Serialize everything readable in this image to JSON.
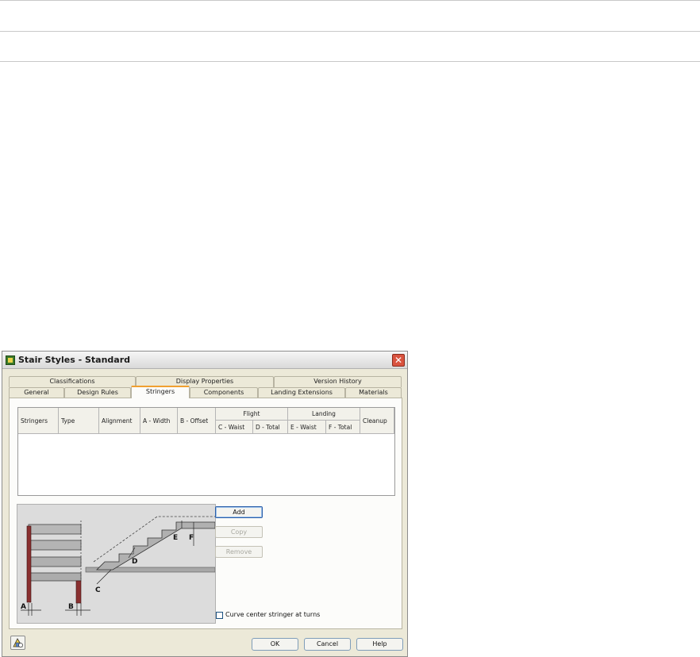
{
  "dialog": {
    "title": "Stair Styles - Standard",
    "close_glyph": "✕"
  },
  "tabs": {
    "row1": [
      {
        "label": "Classifications"
      },
      {
        "label": "Display Properties"
      },
      {
        "label": "Version History"
      }
    ],
    "row2": [
      {
        "label": "General"
      },
      {
        "label": "Design Rules"
      },
      {
        "label": "Stringers",
        "active": true
      },
      {
        "label": "Components"
      },
      {
        "label": "Landing Extensions"
      },
      {
        "label": "Materials"
      }
    ]
  },
  "table": {
    "headers": {
      "stringers": "Stringers",
      "type": "Type",
      "alignment": "Alignment",
      "a_width": "A - Width",
      "b_offset": "B - Offset",
      "flight": "Flight",
      "c_waist": "C - Waist",
      "d_total": "D - Total",
      "landing": "Landing",
      "e_waist": "E - Waist",
      "f_total": "F - Total",
      "cleanup": "Cleanup"
    },
    "rows": []
  },
  "diagram": {
    "labels": {
      "a": "A",
      "b": "B",
      "c": "C",
      "d": "D",
      "e": "E",
      "f": "F"
    }
  },
  "buttons": {
    "add": "Add",
    "copy": "Copy",
    "remove": "Remove"
  },
  "options": {
    "curve_label": "Curve center stringer at turns",
    "curve_checked": false
  },
  "footer": {
    "ok": "OK",
    "cancel": "Cancel",
    "help": "Help"
  },
  "icons": {
    "app": "stair-style-app-icon",
    "close": "close-icon",
    "help_tool": "building-help-icon"
  }
}
